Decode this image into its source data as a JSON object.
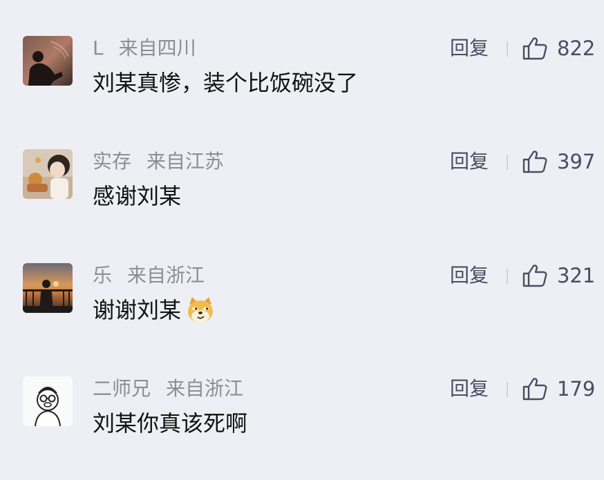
{
  "comments": [
    {
      "username": "L",
      "location": "来自四川",
      "text": "刘某真惨，装个比饭碗没了",
      "reply_label": "回复",
      "likes": "822"
    },
    {
      "username": "实存",
      "location": "来自江苏",
      "text": "感谢刘某",
      "reply_label": "回复",
      "likes": "397"
    },
    {
      "username": "乐",
      "location": "来自浙江",
      "text": "谢谢刘某",
      "emoji": "doge-emoji",
      "reply_label": "回复",
      "likes": "321"
    },
    {
      "username": "二师兄",
      "location": "来自浙江",
      "text": "刘某你真该死啊",
      "reply_label": "回复",
      "likes": "179"
    }
  ],
  "colors": {
    "background": "#eeeff4",
    "meta_gray": "#8d8d93",
    "text_black": "#111111",
    "action_dark": "#4a4b63"
  },
  "icons": {
    "like": "thumbs-up-icon",
    "divider": "vertical-divider"
  }
}
